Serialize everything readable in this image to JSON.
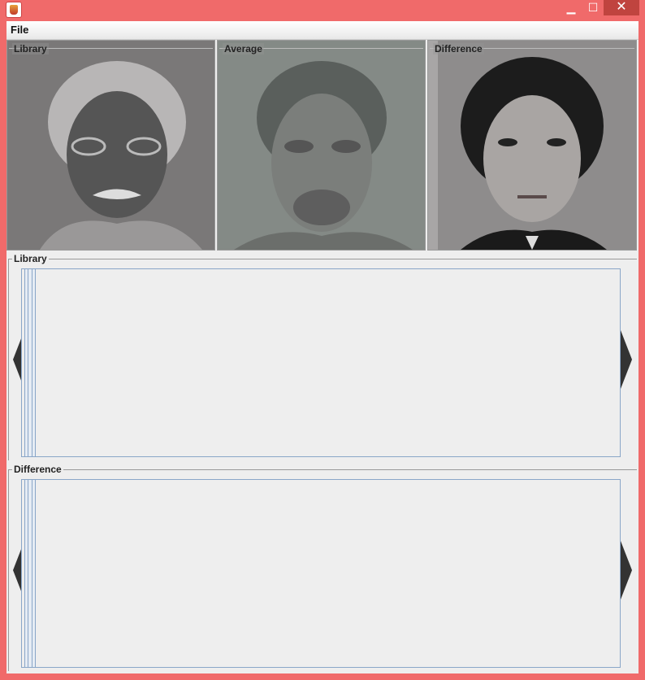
{
  "window": {
    "title": "",
    "minimize_glyph": "▁",
    "maximize_glyph": "☐",
    "close_glyph": "✕"
  },
  "menubar": {
    "file_label": "File"
  },
  "image_panels": [
    {
      "title": "Library",
      "tone": "inverted"
    },
    {
      "title": "Average",
      "tone": "average"
    },
    {
      "title": "Difference",
      "tone": "photo"
    }
  ],
  "library_section": {
    "title": "Library"
  },
  "difference_section": {
    "title": "Difference"
  },
  "colors": {
    "frame": "#f06a6a",
    "close": "#c0443f",
    "client": "#eeeeee",
    "strip_border": "#8aa6c8",
    "arrow": "#333333"
  },
  "icons": {
    "app": "java-cup-icon",
    "prev": "left-arrow-icon",
    "next": "right-arrow-icon"
  }
}
